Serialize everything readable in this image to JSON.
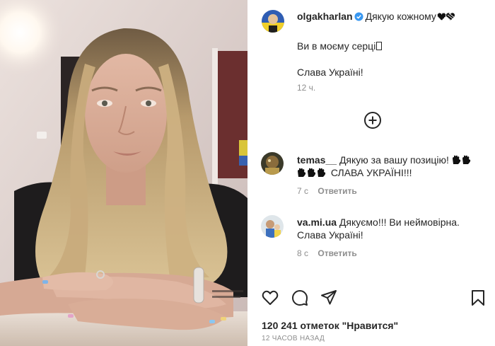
{
  "post": {
    "photo_alt": "",
    "caption": {
      "username": "olgakharlan",
      "text_line1": "Дякую кожному",
      "text_line2": "Ви в моєму серці",
      "text_line3": "Слава Україні!",
      "time": "12 ч."
    },
    "comments": [
      {
        "username": "temas__",
        "text_a": "Дякую за вашу позицію!",
        "text_b": "СЛАВА УКРАЇНІ!!!",
        "time": "7 с",
        "reply_label": "Ответить"
      },
      {
        "username": "va.mi.ua",
        "text_a": "Дякуємо!!! Ви неймовірна.",
        "text_b": "Слава Україні!",
        "time": "8 с",
        "reply_label": "Ответить"
      }
    ],
    "likes_text": "120 241 отметок \"Нравится\"",
    "date_text": "12 ЧАСОВ НАЗАД"
  },
  "icons": {
    "verified": "verified-badge-icon",
    "load_more": "plus-circle-icon",
    "like": "heart-icon",
    "comment": "comment-bubble-icon",
    "share": "paper-plane-icon",
    "save": "bookmark-icon"
  },
  "colors": {
    "verified_blue": "#3897f0",
    "secondary_text": "#8e8e8e",
    "primary_text": "#262626"
  }
}
